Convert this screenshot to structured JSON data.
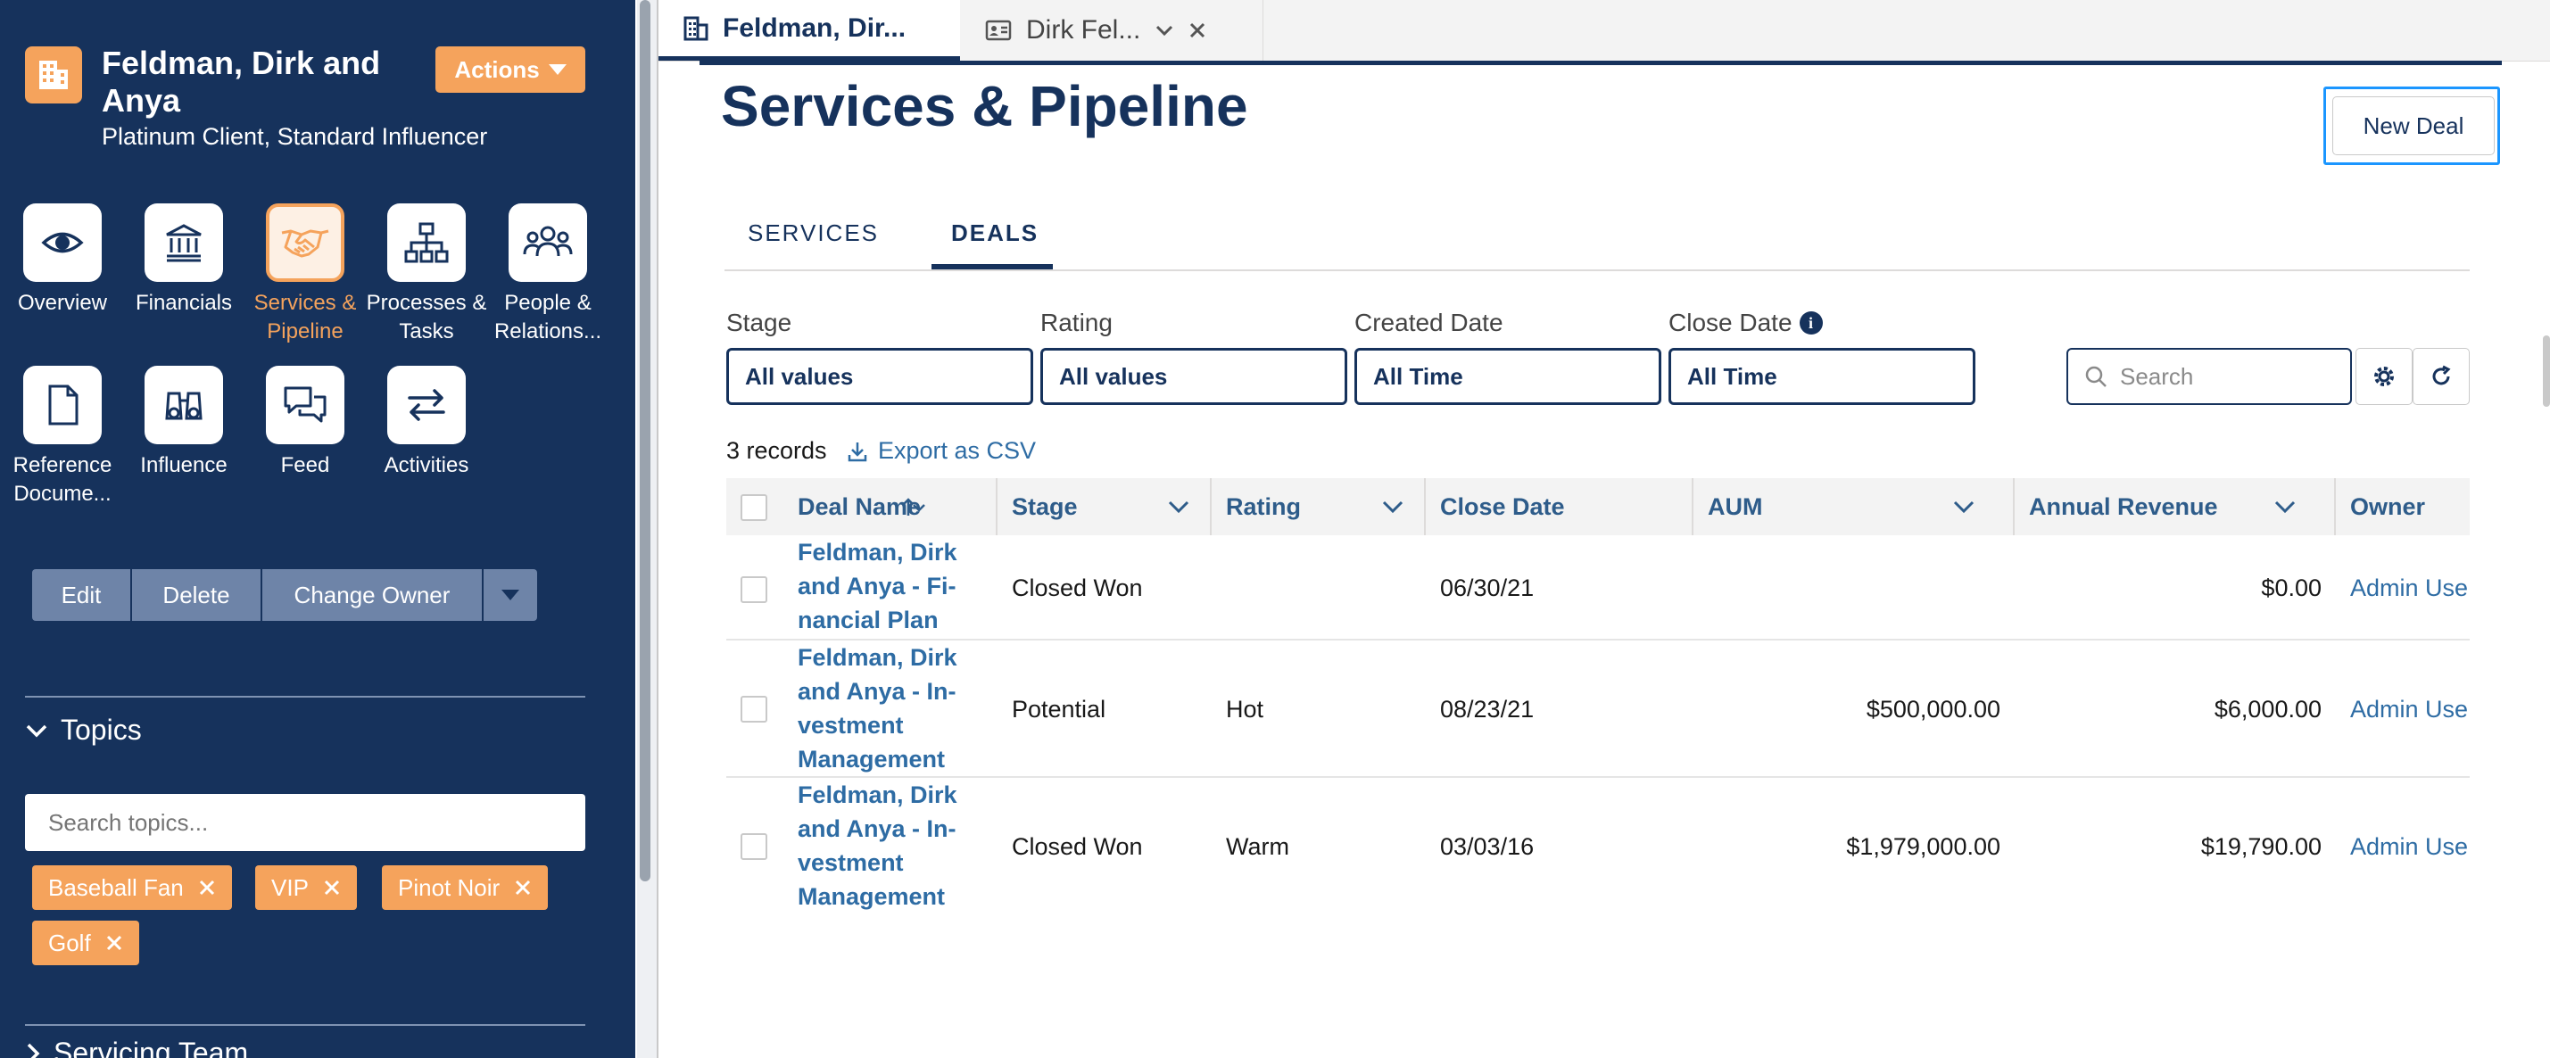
{
  "account": {
    "name": "Feldman, Dirk and Anya",
    "subtitle": "Platinum Client, Standard Influencer",
    "actions_label": "Actions"
  },
  "nav": [
    {
      "label": "Overview",
      "icon": "eye-icon"
    },
    {
      "label": "Financials",
      "icon": "bank-icon"
    },
    {
      "label": "Services & Pipeline",
      "icon": "handshake-icon",
      "active": true
    },
    {
      "label": "Processes & Tasks",
      "icon": "hierarchy-icon"
    },
    {
      "label": "People & Relations...",
      "icon": "people-icon"
    },
    {
      "label": "Reference Docume...",
      "icon": "document-icon"
    },
    {
      "label": "Influence",
      "icon": "binoculars-icon"
    },
    {
      "label": "Feed",
      "icon": "chat-icon"
    },
    {
      "label": "Activities",
      "icon": "swap-arrows-icon"
    }
  ],
  "record_actions": {
    "edit": "Edit",
    "delete": "Delete",
    "change_owner": "Change Owner"
  },
  "topics": {
    "heading": "Topics",
    "search_placeholder": "Search topics...",
    "tags": [
      "Baseball Fan",
      "VIP",
      "Pinot Noir",
      "Golf"
    ]
  },
  "servicing_team": {
    "heading": "Servicing Team"
  },
  "tabs": [
    {
      "label": "Feldman, Dir...",
      "icon": "account-icon",
      "active": true
    },
    {
      "label": "Dirk Fel...",
      "icon": "contact-card-icon",
      "active": false
    }
  ],
  "page": {
    "title": "Services & Pipeline",
    "new_deal": "New Deal",
    "subtabs": [
      "SERVICES",
      "DEALS"
    ],
    "active_subtab": "DEALS"
  },
  "filters": {
    "stage": {
      "label": "Stage",
      "value": "All values"
    },
    "rating": {
      "label": "Rating",
      "value": "All values"
    },
    "created": {
      "label": "Created Date",
      "value": "All Time"
    },
    "close": {
      "label": "Close Date",
      "value": "All Time"
    },
    "search_placeholder": "Search"
  },
  "list": {
    "records": "3 records",
    "export": "Export as CSV"
  },
  "table": {
    "columns": [
      "Deal Name",
      "Stage",
      "Rating",
      "Close Date",
      "AUM",
      "Annual Revenue",
      "Owner"
    ],
    "rows": [
      {
        "name": "Feldman, Dirk and Anya - Fi-nancial Plan",
        "name_lines": [
          "Feldman, Dirk",
          "and Anya - Fi-",
          "nancial Plan"
        ],
        "stage": "Closed Won",
        "rating": "",
        "close_date": "06/30/21",
        "aum": "",
        "annual_revenue": "$0.00",
        "owner": "Admin Use"
      },
      {
        "name": "Feldman, Dirk and Anya - In-vestment Management",
        "name_lines": [
          "Feldman, Dirk",
          "and Anya - In-",
          "vestment",
          "Management"
        ],
        "stage": "Potential",
        "rating": "Hot",
        "close_date": "08/23/21",
        "aum": "$500,000.00",
        "annual_revenue": "$6,000.00",
        "owner": "Admin Use"
      },
      {
        "name": "Feldman, Dirk and Anya - In-vestment Management",
        "name_lines": [
          "Feldman, Dirk",
          "and Anya - In-",
          "vestment",
          "Management"
        ],
        "stage": "Closed Won",
        "rating": "Warm",
        "close_date": "03/03/16",
        "aum": "$1,979,000.00",
        "annual_revenue": "$19,790.00",
        "owner": "Admin Use"
      }
    ]
  },
  "colors": {
    "sidebar": "#16325c",
    "accent_orange": "#f5a35c",
    "link_blue": "#2e6ca4",
    "focus_blue": "#1b96ff"
  }
}
